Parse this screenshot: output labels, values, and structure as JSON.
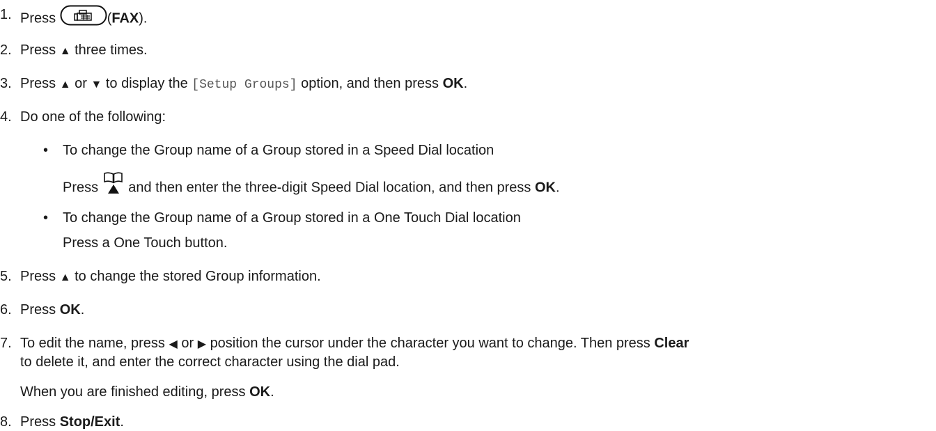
{
  "steps": {
    "s1": {
      "num": "1.",
      "press": "Press",
      "paren_open": "(",
      "key": "FAX",
      "paren_close": ")."
    },
    "s2": {
      "num": "2.",
      "press": "Press",
      "arrow": "▲",
      "rest": "three times."
    },
    "s3": {
      "num": "3.",
      "press": "Press",
      "up": "▲",
      "or": "or",
      "down": "▼",
      "mid": "to display the",
      "option": "[Setup Groups]",
      "end": "option, and then press",
      "ok": "OK",
      "period": "."
    },
    "s4": {
      "num": "4.",
      "text": "Do one of the following:"
    },
    "s4a": {
      "bullet": "•",
      "text": "To change the Group name of a Group stored in a Speed Dial location",
      "press": "Press",
      "rest": "and then enter the three-digit Speed Dial location, and then press",
      "ok": "OK",
      "period": "."
    },
    "s4b": {
      "bullet": "•",
      "text": "To change the Group name of a Group stored in a One Touch Dial location",
      "sub": "Press a One Touch button."
    },
    "s5": {
      "num": "5.",
      "press": "Press",
      "arrow": "▲",
      "rest": "to change the stored Group information."
    },
    "s6": {
      "num": "6.",
      "press": "Press",
      "ok": "OK",
      "period": "."
    },
    "s7": {
      "num": "7.",
      "t1": "To edit the name, press",
      "left": "◀",
      "or": "or",
      "right": "▶",
      "t2": "position the cursor under the character you want to change. Then press",
      "clear": "Clear",
      "t3": "to delete it, and enter the correct character using the dial pad.",
      "t4": "When you are finished editing, press",
      "ok": "OK",
      "period": "."
    },
    "s8": {
      "num": "8.",
      "press": "Press",
      "key": "Stop/Exit",
      "period": "."
    }
  },
  "icons": {
    "fax": "fax-key-icon",
    "addressbook": "address-book-up-key-icon"
  }
}
